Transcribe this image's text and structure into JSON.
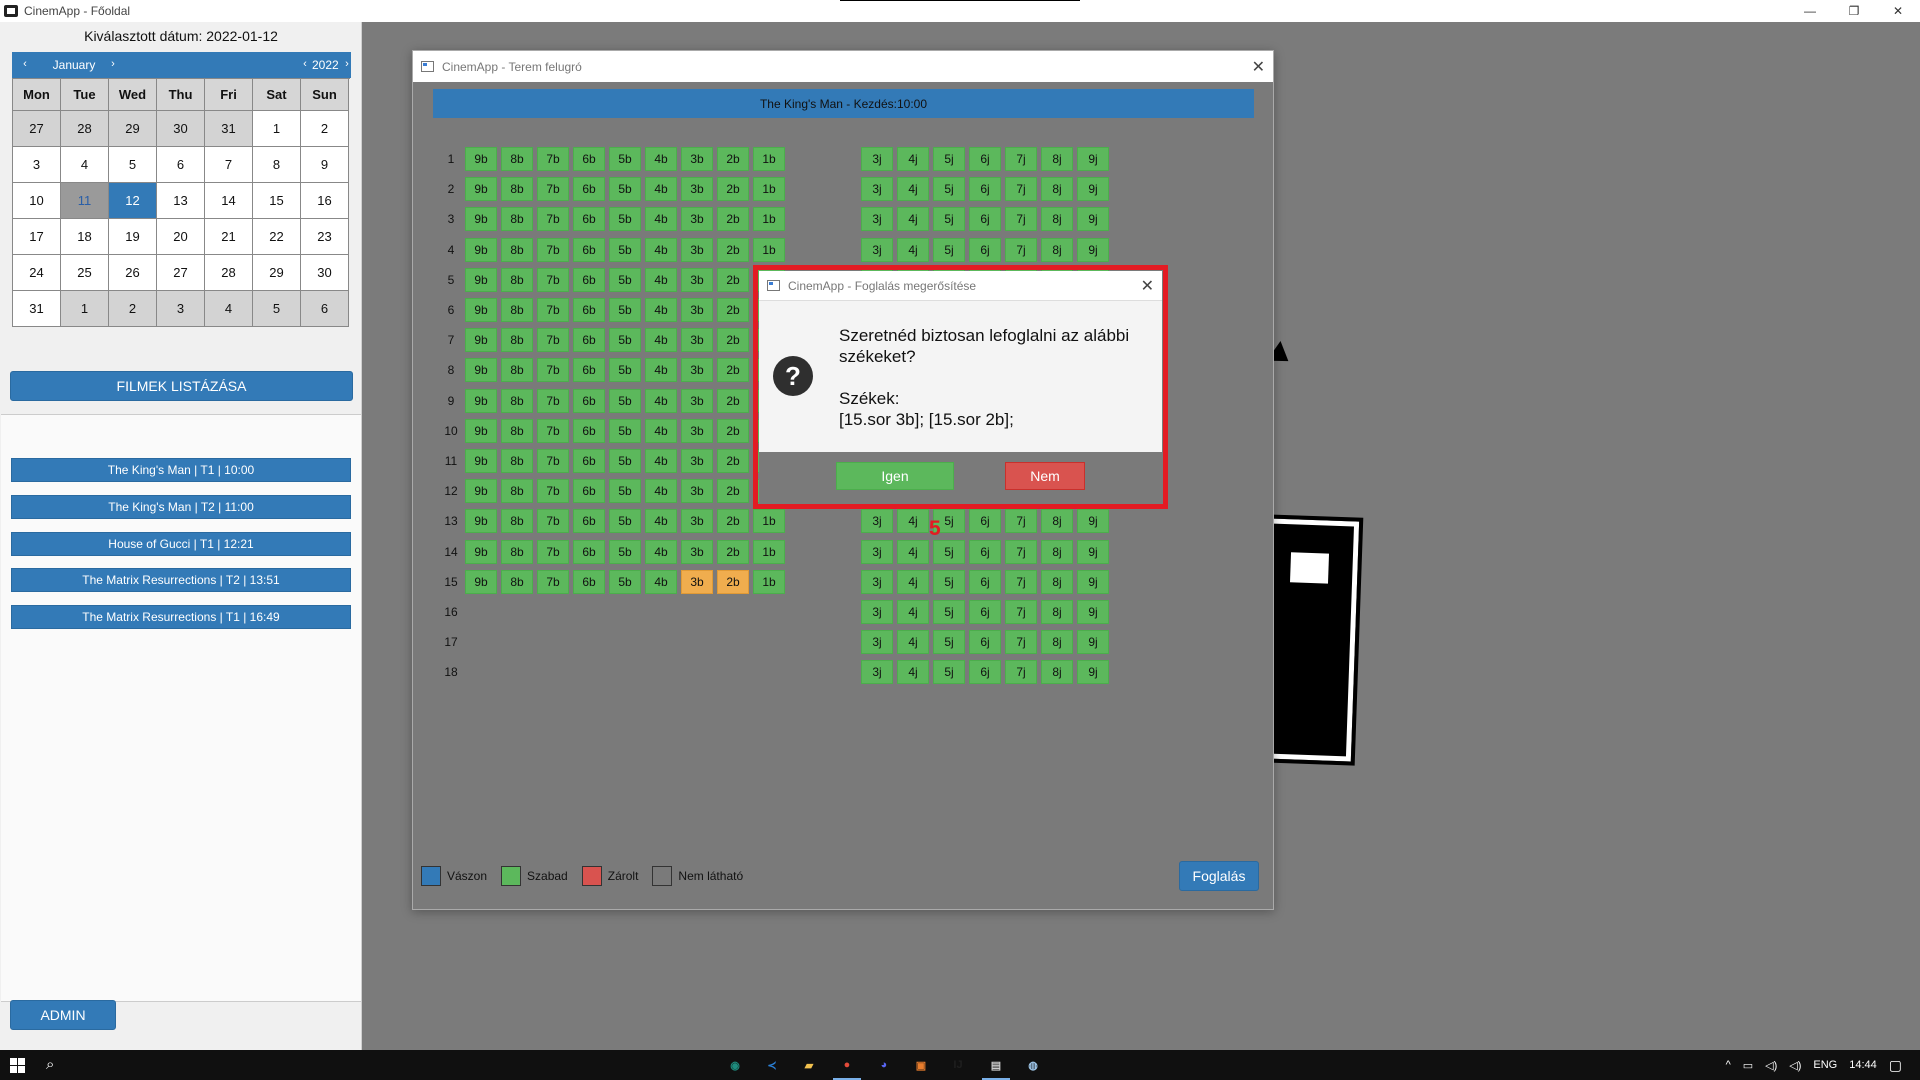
{
  "window": {
    "title": "CinemApp - Főoldal",
    "controls": [
      "—",
      "❐",
      "✕"
    ]
  },
  "sidebar": {
    "selected_date_label": "Kiválasztott dátum: 2022-01-12",
    "calendar": {
      "month": "January",
      "year": "2022",
      "prev": "‹",
      "next": "›",
      "weekdays": [
        "Mon",
        "Tue",
        "Wed",
        "Thu",
        "Fri",
        "Sat",
        "Sun"
      ],
      "weeks": [
        [
          "27",
          "28",
          "29",
          "30",
          "31",
          "1",
          "2"
        ],
        [
          "3",
          "4",
          "5",
          "6",
          "7",
          "8",
          "9"
        ],
        [
          "10",
          "11",
          "12",
          "13",
          "14",
          "15",
          "16"
        ],
        [
          "17",
          "18",
          "19",
          "20",
          "21",
          "22",
          "23"
        ],
        [
          "24",
          "25",
          "26",
          "27",
          "28",
          "29",
          "30"
        ],
        [
          "31",
          "1",
          "2",
          "3",
          "4",
          "5",
          "6"
        ]
      ]
    },
    "list_button": "FILMEK LISTÁZÁSA",
    "movies": [
      "The King's Man | T1 | 10:00",
      "The King's Man | T2 | 11:00",
      "House of Gucci | T1 | 12:21",
      "The Matrix Resurrections | T2 | 13:51",
      "The Matrix Resurrections | T1 | 16:49"
    ],
    "admin_button": "ADMIN"
  },
  "room_dialog": {
    "title": "CinemApp - Terem felugró",
    "close": "✕",
    "screen_label": "The King's Man - Kezdés:10:00",
    "rows": [
      "1",
      "2",
      "3",
      "4",
      "5",
      "6",
      "7",
      "8",
      "9",
      "10",
      "11",
      "12",
      "13",
      "14",
      "15",
      "16",
      "17",
      "18"
    ],
    "left_seats": [
      "9b",
      "8b",
      "7b",
      "6b",
      "5b",
      "4b",
      "3b",
      "2b",
      "1b"
    ],
    "right_seats": [
      "3j",
      "4j",
      "5j",
      "6j",
      "7j",
      "8j",
      "9j"
    ],
    "left_rows_count": 15,
    "selected_seats": [
      {
        "row": "15",
        "seat": "3b"
      },
      {
        "row": "15",
        "seat": "2b"
      }
    ],
    "legend": [
      {
        "label": "Vászon",
        "color": "#337ab7"
      },
      {
        "label": "Szabad",
        "color": "#5cb85c"
      },
      {
        "label": "Zárolt",
        "color": "#d9534f"
      },
      {
        "label": "Nem látható",
        "color": "#7a7a7a"
      }
    ],
    "book_button": "Foglalás"
  },
  "confirm_dialog": {
    "title": "CinemApp - Foglalás megerősítése",
    "close": "✕",
    "question_line1": "Szeretnéd biztosan lefoglalni az alábbi székeket?",
    "seats_heading": "Székek:",
    "seats_value": "[15.sor 3b]; [15.sor 2b];",
    "yes_button": "Igen",
    "no_button": "Nem",
    "highlight_color": "#e31b23"
  },
  "annotation": {
    "step_number": "5"
  },
  "taskbar": {
    "search_icon": "⌕",
    "apps": [
      {
        "name": "app-icon-1",
        "glyph": "◉",
        "color": "#1e8c7e"
      },
      {
        "name": "vscode-icon",
        "glyph": "≺",
        "color": "#2b7fd4"
      },
      {
        "name": "file-explorer-icon",
        "glyph": "▰",
        "color": "#f2c14e"
      },
      {
        "name": "chrome-icon",
        "glyph": "●",
        "color": "#e44b3a"
      },
      {
        "name": "discord-icon",
        "glyph": "◕",
        "color": "#5865f2"
      },
      {
        "name": "app-icon-6",
        "glyph": "▣",
        "color": "#e87d2d"
      },
      {
        "name": "intellij-icon",
        "glyph": "IJ",
        "color": "#1f1f1f"
      },
      {
        "name": "cinemapp-icon",
        "glyph": "▤",
        "color": "#cccccc"
      },
      {
        "name": "app-icon-9",
        "glyph": "◍",
        "color": "#9fc7ea"
      }
    ],
    "tray": {
      "chevron": "^",
      "language": "ENG",
      "time": "14:44"
    }
  }
}
